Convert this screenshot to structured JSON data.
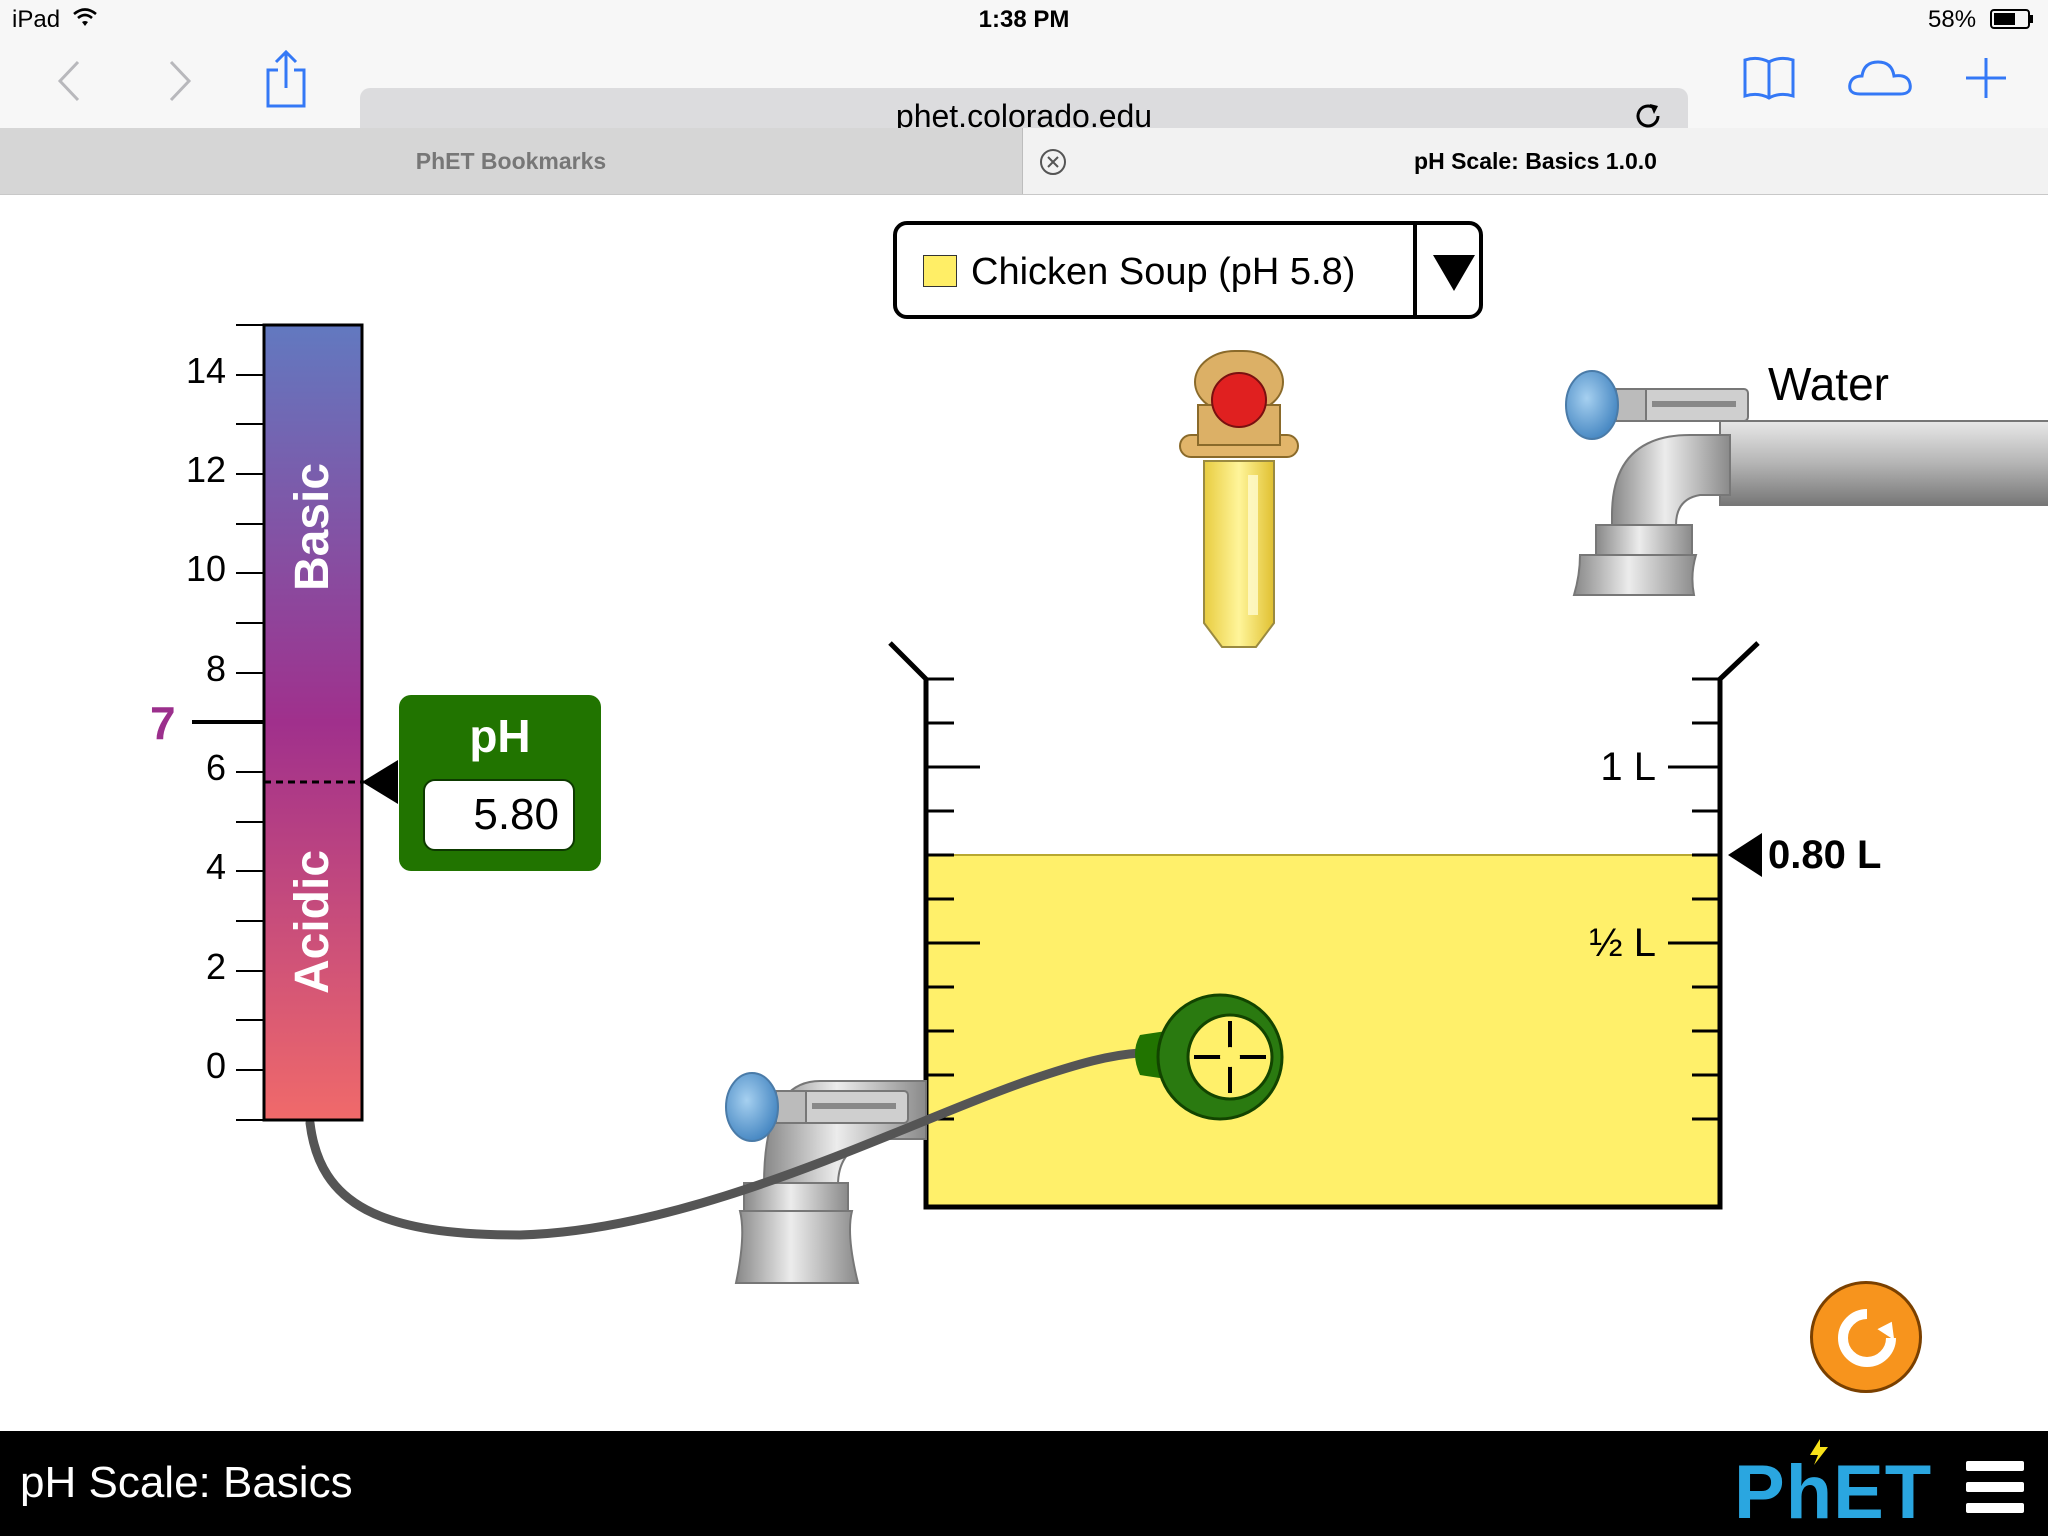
{
  "status": {
    "device": "iPad",
    "time": "1:38 PM",
    "battery": "58%"
  },
  "browser": {
    "url": "phet.colorado.edu",
    "icons": [
      "back-icon",
      "forward-icon",
      "share-icon",
      "reload-icon",
      "bookmarks-icon",
      "cloud-tabs-icon",
      "new-tab-icon"
    ],
    "tabs": [
      {
        "label": "PhET Bookmarks",
        "active": false
      },
      {
        "label": "pH Scale: Basics 1.0.0",
        "active": true
      }
    ]
  },
  "sim": {
    "solute_dropdown": {
      "selected": "Chicken Soup (pH 5.8)",
      "swatch": "#ffee66"
    },
    "ph_scale": {
      "ticks": [
        "14",
        "12",
        "10",
        "8",
        "6",
        "4",
        "2",
        "0"
      ],
      "neutral": "7",
      "basic_label": "Basic",
      "acidic_label": "Acidic",
      "top_color": "#6279c0",
      "mid_color": "#a0308c",
      "bottom_color": "#f06a6a"
    },
    "ph_meter": {
      "title": "pH",
      "value": "5.80",
      "value_num": 5.8,
      "color": "#217400"
    },
    "water_faucet_label": "Water",
    "beaker": {
      "labels": {
        "one_liter": "1 L",
        "half_liter": "½ L"
      },
      "volume_readout": "0.80 L",
      "volume_fraction": 0.8,
      "solution_color": "#fff06a"
    },
    "reset_icon": "reset-all-icon"
  },
  "footer": {
    "title": "pH Scale: Basics",
    "logo": "PhET",
    "menu_icon": "hamburger-menu-icon"
  }
}
